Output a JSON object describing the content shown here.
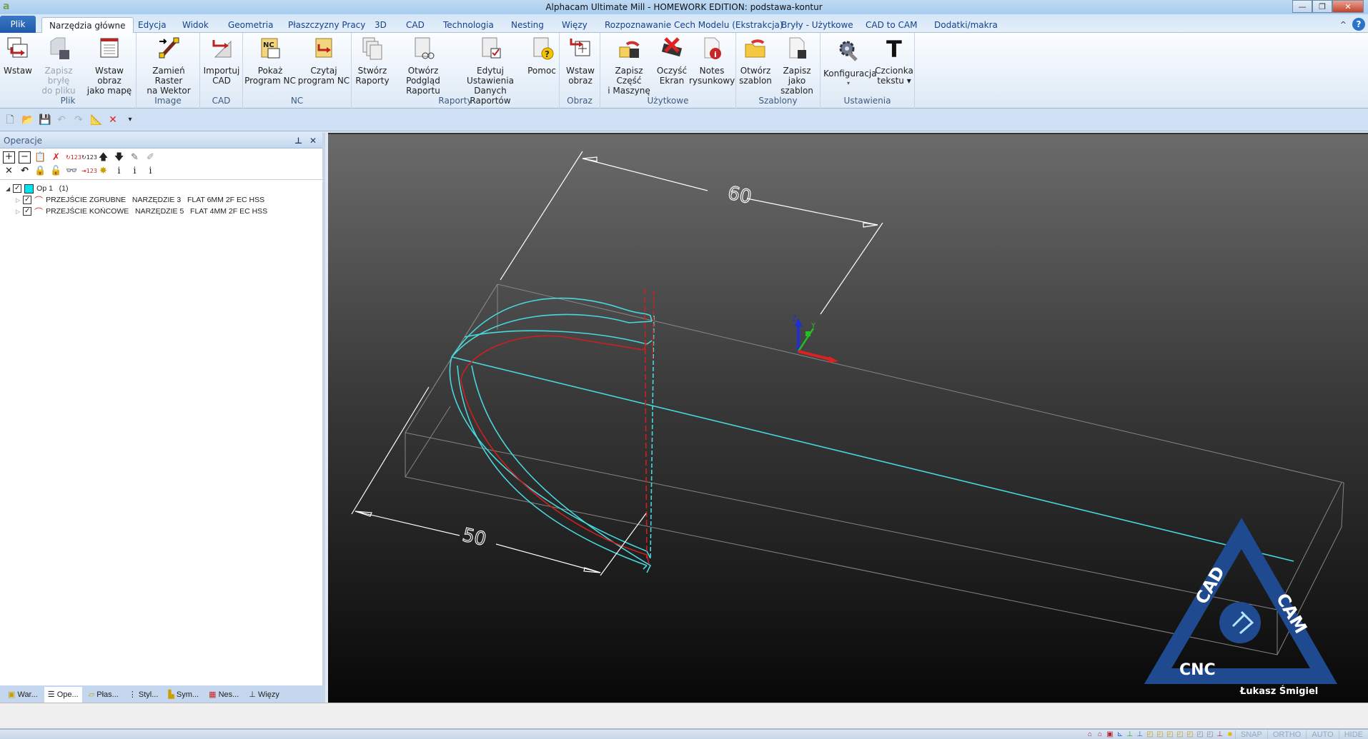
{
  "window": {
    "title": "Alphacam Ultimate Mill - HOMEWORK EDITION: podstawa-kontur",
    "app_icon": "alphacam-logo",
    "minimize": "—",
    "restore": "❐",
    "close": "✕"
  },
  "tabs": [
    {
      "label": "Plik"
    },
    {
      "label": "Narzędzia główne"
    },
    {
      "label": "Edycja"
    },
    {
      "label": "Widok"
    },
    {
      "label": "Geometria"
    },
    {
      "label": "Płaszczyzny Pracy"
    },
    {
      "label": "3D"
    },
    {
      "label": "CAD"
    },
    {
      "label": "Technologia"
    },
    {
      "label": "Nesting"
    },
    {
      "label": "Więzy"
    },
    {
      "label": "Rozpoznawanie Cech Modelu (Ekstrakcja)"
    },
    {
      "label": "Bryły - Użytkowe"
    },
    {
      "label": "CAD to CAM"
    },
    {
      "label": "Dodatki/makra"
    }
  ],
  "tab_right": {
    "collapse": "^",
    "help": "?"
  },
  "ribbon": {
    "groups": [
      {
        "label": "Plik",
        "buttons": [
          {
            "l1": "Wstaw",
            "l2": "",
            "icon": "insert-icon"
          },
          {
            "l1": "Zapisz bryłę",
            "l2": "do pliku",
            "icon": "save-solid-icon",
            "disabled": true
          },
          {
            "l1": "Wstaw obraz",
            "l2": "jako mapę",
            "icon": "insert-image-map-icon"
          }
        ]
      },
      {
        "label": "Image",
        "buttons": [
          {
            "l1": "Zamień Raster",
            "l2": "na Wektor",
            "icon": "raster-to-vector-icon"
          }
        ]
      },
      {
        "label": "CAD",
        "buttons": [
          {
            "l1": "Importuj",
            "l2": "CAD",
            "icon": "import-cad-icon"
          }
        ]
      },
      {
        "label": "NC",
        "buttons": [
          {
            "l1": "Pokaż",
            "l2": "Program NC",
            "icon": "show-nc-icon"
          },
          {
            "l1": "Czytaj",
            "l2": "program NC",
            "icon": "read-nc-icon"
          }
        ]
      },
      {
        "label": "Raporty",
        "buttons": [
          {
            "l1": "Stwórz",
            "l2": "Raporty",
            "icon": "create-reports-icon"
          },
          {
            "l1": "Otwórz Podgląd",
            "l2": "Raportu",
            "icon": "report-preview-icon"
          },
          {
            "l1": "Edytuj Ustawienia",
            "l2": "Danych Raportów",
            "icon": "edit-report-settings-icon"
          },
          {
            "l1": "Pomoc",
            "l2": "",
            "icon": "report-help-icon"
          }
        ]
      },
      {
        "label": "Obraz",
        "buttons": [
          {
            "l1": "Wstaw",
            "l2": "obraz",
            "icon": "insert-picture-icon"
          }
        ]
      },
      {
        "label": "Użytkowe",
        "buttons": [
          {
            "l1": "Zapisz Część",
            "l2": "i Maszynę",
            "icon": "save-part-machine-icon"
          },
          {
            "l1": "Oczyść",
            "l2": "Ekran",
            "icon": "clear-screen-icon"
          },
          {
            "l1": "Notes",
            "l2": "rysunkowy",
            "icon": "drawing-notes-icon"
          }
        ]
      },
      {
        "label": "Szablony",
        "buttons": [
          {
            "l1": "Otwórz",
            "l2": "szablon",
            "icon": "open-template-icon"
          },
          {
            "l1": "Zapisz jako",
            "l2": "szablon",
            "icon": "save-template-icon"
          }
        ]
      },
      {
        "label": "Ustawienia",
        "buttons": [
          {
            "l1": "Konfiguracja",
            "l2": "▾",
            "icon": "configuration-icon"
          },
          {
            "l1": "Czcionka",
            "l2": "tekstu ▾",
            "icon": "text-font-icon"
          }
        ]
      }
    ]
  },
  "qat": [
    "new-icon",
    "open-icon",
    "save-icon",
    "undo-icon",
    "redo-icon",
    "measure-icon",
    "delete-icon",
    "customize-icon"
  ],
  "panel": {
    "title": "Operacje",
    "pin": "📌",
    "close": "✕",
    "tree": {
      "root": {
        "label": "Op 1   (1)",
        "checked": true,
        "color": "#00e5ee"
      },
      "children": [
        {
          "label": "PRZEJŚCIE ZGRUBNE   NARZĘDZIE 3   FLAT 6MM 2F EC HSS",
          "checked": true
        },
        {
          "label": "PRZEJŚCIE KOŃCOWE   NARZĘDZIE 5   FLAT 4MM 2F EC HSS",
          "checked": true
        }
      ]
    },
    "bottom_tabs": [
      {
        "label": "War..."
      },
      {
        "label": "Ope...",
        "active": true
      },
      {
        "label": "Płas..."
      },
      {
        "label": "Styl..."
      },
      {
        "label": "Sym..."
      },
      {
        "label": "Nes..."
      },
      {
        "label": "Więzy"
      }
    ]
  },
  "viewport": {
    "dimensions": {
      "top": "60",
      "left": "50"
    },
    "axes": {
      "x": "X",
      "y": "Y",
      "z": "Z"
    },
    "colors": {
      "toolpath": "#cc2020",
      "geometry": "#48d8dc",
      "dimension": "#ffffff",
      "box": "#8a8a8a",
      "x_axis": "#e02020",
      "y_axis": "#20c020",
      "z_axis": "#2030d0"
    },
    "logo": {
      "top": "CAD",
      "right": "CAM",
      "bottom": "CNC",
      "author": "Łukasz Śmigiel",
      "color": "#1f4a8f"
    }
  },
  "statusbar": {
    "toggles": [
      "SNAP",
      "ORTHO",
      "AUTO",
      "HIDE"
    ]
  }
}
